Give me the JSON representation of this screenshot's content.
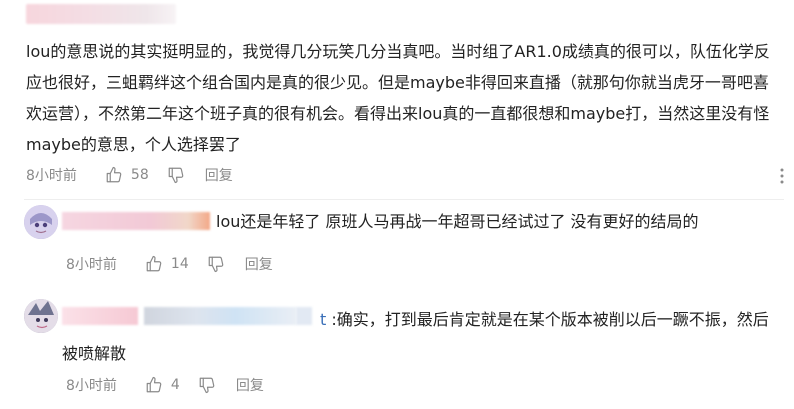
{
  "main_comment": {
    "text": "lou的意思说的其实挺明显的，我觉得几分玩笑几分当真吧。当时组了AR1.0成绩真的很可以，队伍化学反应也很好，三蛆羁绊这个组合国内是真的很少见。但是maybe非得回来直播（就那句你就当虎牙一哥吧喜欢运营），不然第二年这个班子真的很有机会。看得出来lou真的一直都很想和maybe打，当然这里没有怪maybe的意思，个人选择罢了",
    "time": "8小时前",
    "likes": "58",
    "reply_label": "回复"
  },
  "replies": [
    {
      "text": "lou还是年轻了 原班人马再战一年超哥已经试过了 没有更好的结局的",
      "time": "8小时前",
      "likes": "14",
      "reply_label": "回复"
    },
    {
      "name_tail": "t",
      "text": ":确实，打到最后肯定就是在某个版本被削以后一蹶不振，然后被喷解散",
      "time": "8小时前",
      "likes": "4",
      "reply_label": "回复"
    }
  ],
  "icons": {
    "like": "thumbs-up-icon",
    "dislike": "thumbs-down-icon",
    "more": "more-vertical-icon"
  },
  "colors": {
    "meta_text": "#8a8a8a",
    "body_text": "#222222",
    "link_blue": "#3a6fb8"
  }
}
